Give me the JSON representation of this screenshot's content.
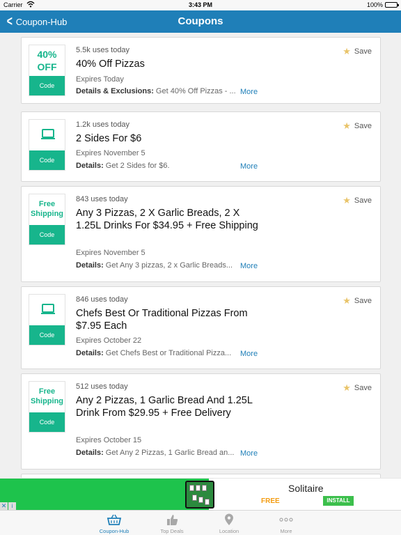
{
  "status_bar": {
    "carrier": "Carrier",
    "time": "3:43 PM",
    "battery": "100%"
  },
  "nav": {
    "back_label": "Coupon-Hub",
    "title": "Coupons"
  },
  "colors": {
    "nav": "#1f7fb8",
    "accent": "#17b58c",
    "link": "#1f7fb8",
    "star": "#e9c46a"
  },
  "save_label": "Save",
  "code_label": "Code",
  "more_label": "More",
  "coupons": [
    {
      "badge_type": "text",
      "badge_line1": "40%",
      "badge_line2": "OFF",
      "uses": "5.5k uses today",
      "title": "40% Off Pizzas",
      "expires": "Expires Today",
      "details_label": "Details & Exclusions:",
      "details_text": " Get 40% Off Pizzas - ..."
    },
    {
      "badge_type": "laptop-icon",
      "uses": "1.2k uses today",
      "title": "2 Sides For $6",
      "expires": "Expires November 5",
      "details_label": "Details:",
      "details_text": " Get 2 Sides for $6."
    },
    {
      "badge_type": "text",
      "badge_line1": "Free",
      "badge_line2": "Shipping",
      "uses": "843 uses today",
      "title": "Any 3 Pizzas, 2 X Garlic Breads, 2 X 1.25L Drinks For $34.95 + Free Shipping",
      "expires": "Expires November 5",
      "details_label": "Details:",
      "details_text": " Get Any 3 pizzas, 2 x Garlic Breads..."
    },
    {
      "badge_type": "laptop-icon",
      "uses": "846 uses today",
      "title": "Chefs Best Or Traditional Pizzas From $7.95 Each",
      "expires": "Expires October 22",
      "details_label": "Details:",
      "details_text": " Get Chefs Best or Traditional Pizza..."
    },
    {
      "badge_type": "text",
      "badge_line1": "Free",
      "badge_line2": "Shipping",
      "uses": "512 uses today",
      "title": "Any 2 Pizzas, 1 Garlic Bread And 1.25L Drink From $29.95 + Free Delivery",
      "expires": "Expires October 15",
      "details_label": "Details:",
      "details_text": " Get Any 2 Pizzas, 1 Garlic Bread an..."
    }
  ],
  "ad": {
    "name": "Solitaire",
    "free": "FREE",
    "install": "INSTALL"
  },
  "tabs": [
    {
      "label": "Coupon-Hub",
      "icon": "basket-icon",
      "active": true
    },
    {
      "label": "Top Deals",
      "icon": "thumbs-up-icon",
      "active": false
    },
    {
      "label": "Location",
      "icon": "location-pin-icon",
      "active": false
    },
    {
      "label": "More",
      "icon": "ellipsis-icon",
      "active": false
    }
  ]
}
